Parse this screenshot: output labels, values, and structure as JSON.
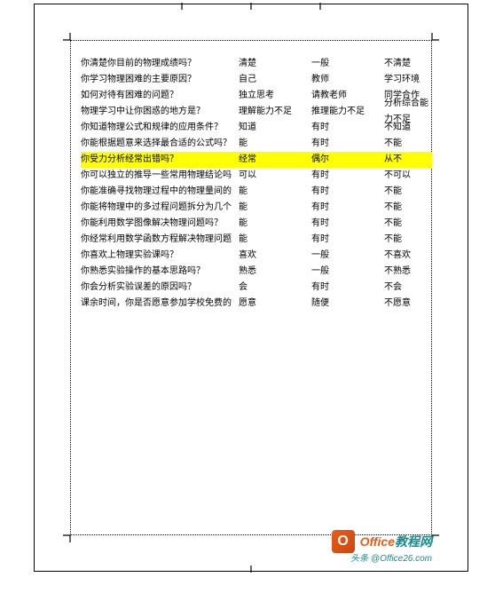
{
  "rows": [
    {
      "q": "你清楚你目前的物理成绩吗？",
      "o1": "清楚",
      "o2": "一般",
      "o3": "不清楚",
      "hl": false
    },
    {
      "q": "你学习物理困难的主要原因？",
      "o1": "自己",
      "o2": "教师",
      "o3": "学习环境",
      "hl": false
    },
    {
      "q": "如何对待有困难的问题？",
      "o1": "独立思考",
      "o2": "请教老师",
      "o3": "同学合作",
      "hl": false
    },
    {
      "q": "物理学习中让你困惑的地方是？",
      "o1": "理解能力不足",
      "o2": "推理能力不足",
      "o3": "分析综合能力不足",
      "hl": false
    },
    {
      "q": "你知道物理公式和规律的应用条件？",
      "o1": "知道",
      "o2": "有时",
      "o3": "不知道",
      "hl": false
    },
    {
      "q": "你能根据题意来选择最合适的公式吗？",
      "o1": "能",
      "o2": "有时",
      "o3": "不能",
      "hl": false
    },
    {
      "q": "你受力分析经常出错吗？",
      "o1": "经常",
      "o2": "偶尔",
      "o3": "从不",
      "hl": true
    },
    {
      "q": "你可以独立的推导一些常用物理结论吗",
      "o1": "可以",
      "o2": "有时",
      "o3": "不可以",
      "hl": false
    },
    {
      "q": "你能准确寻找物理过程中的物理量间的",
      "o1": "能",
      "o2": "有时",
      "o3": "不能",
      "hl": false
    },
    {
      "q": "你能将物理中的多过程问题拆分为几个",
      "o1": "能",
      "o2": "有时",
      "o3": "不能",
      "hl": false
    },
    {
      "q": "你能利用数学图像解决物理问题吗？",
      "o1": "能",
      "o2": "有时",
      "o3": "不能",
      "hl": false
    },
    {
      "q": "你经常利用数学函数方程解决物理问题",
      "o1": "能",
      "o2": "有时",
      "o3": "不能",
      "hl": false
    },
    {
      "q": "你喜欢上物理实验课吗？",
      "o1": "喜欢",
      "o2": "一般",
      "o3": "不喜欢",
      "hl": false
    },
    {
      "q": "你熟悉实验操作的基本思路吗？",
      "o1": "熟悉",
      "o2": "一般",
      "o3": "不熟悉",
      "hl": false
    },
    {
      "q": "你会分析实验误差的原因吗？",
      "o1": "会",
      "o2": "有时",
      "o3": "不会",
      "hl": false
    },
    {
      "q": "课余时间，你是否愿意参加学校免费的",
      "o1": "愿意",
      "o2": "随便",
      "o3": "不愿意",
      "hl": false
    }
  ],
  "watermark": {
    "icon": "O",
    "text1": "Office",
    "text2": "教程网",
    "sub": "头条 @Office26.com"
  }
}
